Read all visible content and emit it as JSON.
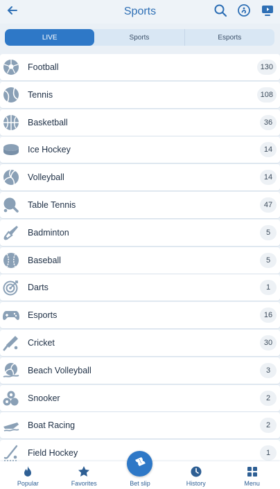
{
  "header": {
    "title": "Sports",
    "back_icon": "arrow-left-icon",
    "icons": [
      "search-icon",
      "support-icon",
      "video-icon"
    ]
  },
  "tabs": [
    {
      "label": "LIVE",
      "active": true
    },
    {
      "label": "Sports",
      "active": false
    },
    {
      "label": "Esports",
      "active": false
    }
  ],
  "sports": [
    {
      "name": "Football",
      "count": "130",
      "icon": "football-icon"
    },
    {
      "name": "Tennis",
      "count": "108",
      "icon": "tennis-icon"
    },
    {
      "name": "Basketball",
      "count": "36",
      "icon": "basketball-icon"
    },
    {
      "name": "Ice Hockey",
      "count": "14",
      "icon": "ice-hockey-icon"
    },
    {
      "name": "Volleyball",
      "count": "14",
      "icon": "volleyball-icon"
    },
    {
      "name": "Table Tennis",
      "count": "47",
      "icon": "table-tennis-icon"
    },
    {
      "name": "Badminton",
      "count": "5",
      "icon": "badminton-icon"
    },
    {
      "name": "Baseball",
      "count": "5",
      "icon": "baseball-icon"
    },
    {
      "name": "Darts",
      "count": "1",
      "icon": "darts-icon"
    },
    {
      "name": "Esports",
      "count": "16",
      "icon": "gamepad-icon"
    },
    {
      "name": "Cricket",
      "count": "30",
      "icon": "cricket-icon"
    },
    {
      "name": "Beach Volleyball",
      "count": "3",
      "icon": "beach-volleyball-icon"
    },
    {
      "name": "Snooker",
      "count": "2",
      "icon": "snooker-icon"
    },
    {
      "name": "Boat Racing",
      "count": "2",
      "icon": "boat-icon"
    },
    {
      "name": "Field Hockey",
      "count": "1",
      "icon": "field-hockey-icon"
    }
  ],
  "bottom_nav": [
    {
      "label": "Popular",
      "icon": "flame-icon"
    },
    {
      "label": "Favorites",
      "icon": "star-icon"
    },
    {
      "label": "Bet slip",
      "icon": "ticket-icon"
    },
    {
      "label": "History",
      "icon": "clock-icon"
    },
    {
      "label": "Menu",
      "icon": "grid-icon"
    }
  ],
  "colors": {
    "accent": "#2e78c7",
    "icon": "#8aa0b6",
    "background": "#eaf0f6"
  }
}
